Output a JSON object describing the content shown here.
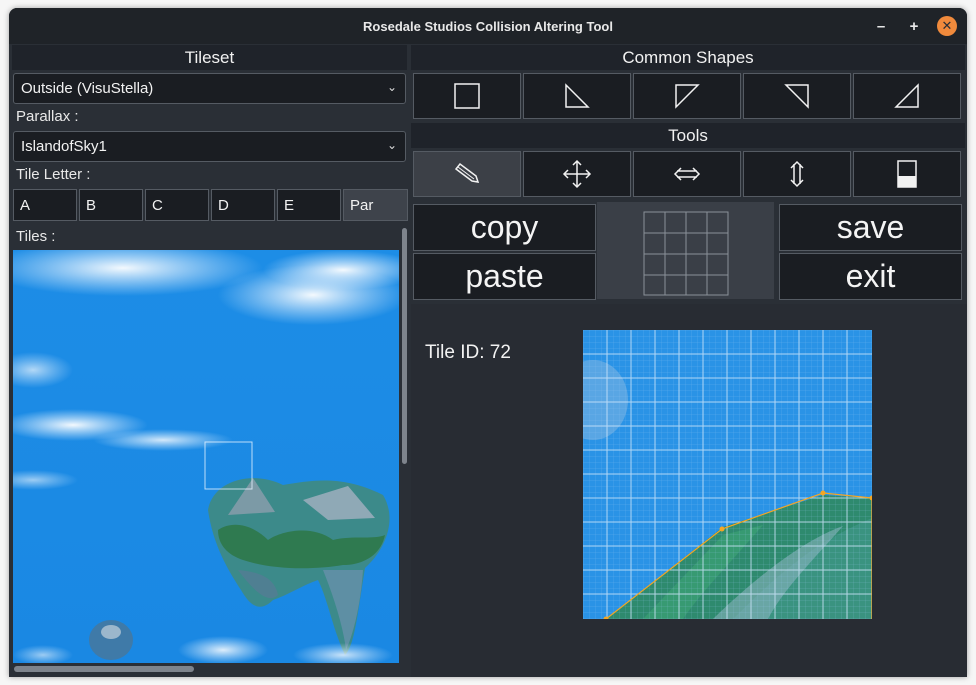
{
  "window": {
    "title": "Rosedale Studios Collision Altering Tool"
  },
  "titlebar": {
    "minimize": "–",
    "maximize": "+",
    "close": "✕"
  },
  "left": {
    "header": "Tileset",
    "tileset_value": "Outside (VisuStella)",
    "parallax_label": "Parallax :",
    "parallax_value": "IslandofSky1",
    "tile_letter_label": "Tile Letter :",
    "letters": [
      "A",
      "B",
      "C",
      "D",
      "E",
      "Par"
    ],
    "tiles_label": "Tiles :"
  },
  "right": {
    "common_shapes_header": "Common Shapes",
    "shapes": [
      "square-shape-icon",
      "triangle-bottom-left-icon",
      "triangle-top-left-icon",
      "triangle-top-right-icon",
      "triangle-bottom-right-icon"
    ],
    "tools_header": "Tools",
    "tools": [
      "pencil-icon",
      "move-icon",
      "horizontal-arrows-icon",
      "vertical-arrows-icon",
      "fill-icon"
    ],
    "copy_label": "copy",
    "paste_label": "paste",
    "save_label": "save",
    "exit_label": "exit"
  },
  "editor": {
    "tile_id_label": "Tile ID: 72"
  },
  "colors": {
    "accent": "#f08a3c",
    "sky": "#1e8fe8",
    "polyline": "#f5a623"
  }
}
